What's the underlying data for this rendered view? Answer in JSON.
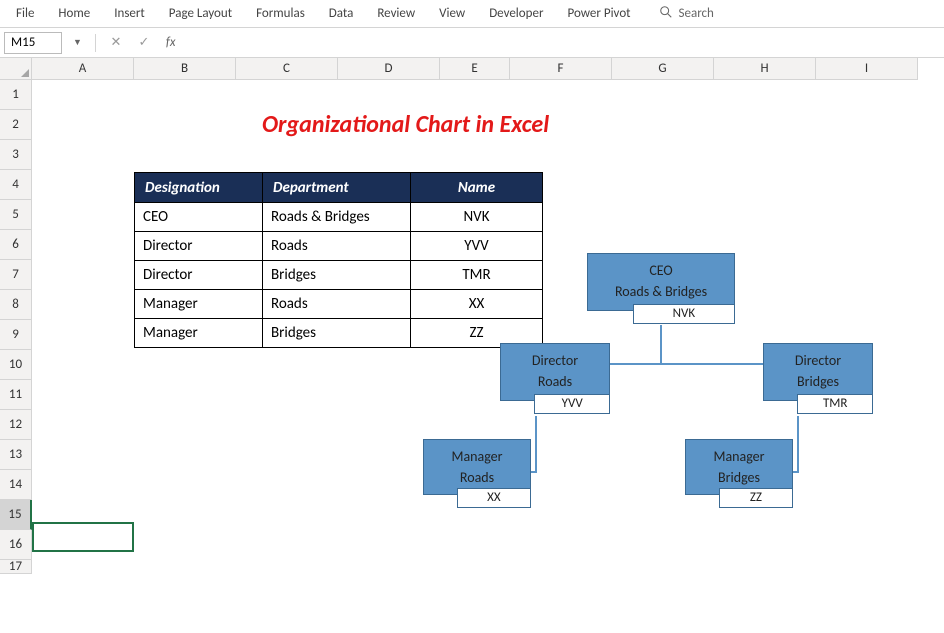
{
  "ribbon": {
    "tabs": [
      "File",
      "Home",
      "Insert",
      "Page Layout",
      "Formulas",
      "Data",
      "Review",
      "View",
      "Developer",
      "Power Pivot"
    ],
    "search_placeholder": "Search"
  },
  "formula_bar": {
    "name_box": "M15",
    "fx": "fx"
  },
  "columns": [
    "A",
    "B",
    "C",
    "D",
    "E",
    "F",
    "G",
    "H",
    "I"
  ],
  "rows": [
    "1",
    "2",
    "3",
    "4",
    "5",
    "6",
    "7",
    "8",
    "9",
    "10",
    "11",
    "12",
    "13",
    "14",
    "15",
    "16",
    "17"
  ],
  "selected_row": "15",
  "title": "Organizational Chart in Excel",
  "table": {
    "headers": {
      "designation": "Designation",
      "department": "Department",
      "name": "Name"
    },
    "rows": [
      {
        "designation": "CEO",
        "department": "Roads & Bridges",
        "name": "NVK"
      },
      {
        "designation": "Director",
        "department": "Roads",
        "name": "YVV"
      },
      {
        "designation": "Director",
        "department": "Bridges",
        "name": "TMR"
      },
      {
        "designation": "Manager",
        "department": "Roads",
        "name": "XX"
      },
      {
        "designation": "Manager",
        "department": "Bridges",
        "name": "ZZ"
      }
    ]
  },
  "org": {
    "ceo": {
      "title": "CEO",
      "dept": "Roads & Bridges",
      "name": "NVK"
    },
    "dir1": {
      "title": "Director",
      "dept": "Roads",
      "name": "YVV"
    },
    "dir2": {
      "title": "Director",
      "dept": "Bridges",
      "name": "TMR"
    },
    "mgr1": {
      "title": "Manager",
      "dept": "Roads",
      "name": "XX"
    },
    "mgr2": {
      "title": "Manager",
      "dept": "Bridges",
      "name": "ZZ"
    }
  },
  "chart_data": {
    "type": "org-hierarchy",
    "nodes": [
      {
        "id": "ceo",
        "title": "CEO",
        "department": "Roads & Bridges",
        "name": "NVK",
        "parent": null
      },
      {
        "id": "dir1",
        "title": "Director",
        "department": "Roads",
        "name": "YVV",
        "parent": "ceo"
      },
      {
        "id": "dir2",
        "title": "Director",
        "department": "Bridges",
        "name": "TMR",
        "parent": "ceo"
      },
      {
        "id": "mgr1",
        "title": "Manager",
        "department": "Roads",
        "name": "XX",
        "parent": "dir1"
      },
      {
        "id": "mgr2",
        "title": "Manager",
        "department": "Bridges",
        "name": "ZZ",
        "parent": "dir2"
      }
    ]
  }
}
